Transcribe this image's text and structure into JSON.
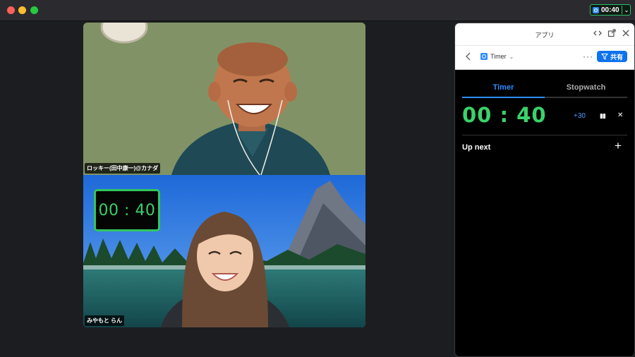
{
  "titlebar": {
    "timer_value": "00:40",
    "chevron": "⌄"
  },
  "videos": [
    {
      "name": "ロッキー(田中康一)@カナダ"
    },
    {
      "name": "みやもと らん",
      "overlay_timer": "00 : 40"
    }
  ],
  "panel": {
    "title": "アプリ",
    "app_name": "Timer",
    "share_label": "共有",
    "tabs": [
      "Timer",
      "Stopwatch"
    ],
    "active_tab": "Timer",
    "time": "00 : 40",
    "add_time": "+30",
    "up_next": "Up next",
    "accent": "#2d8cff",
    "timer_green": "#3bd26b"
  }
}
